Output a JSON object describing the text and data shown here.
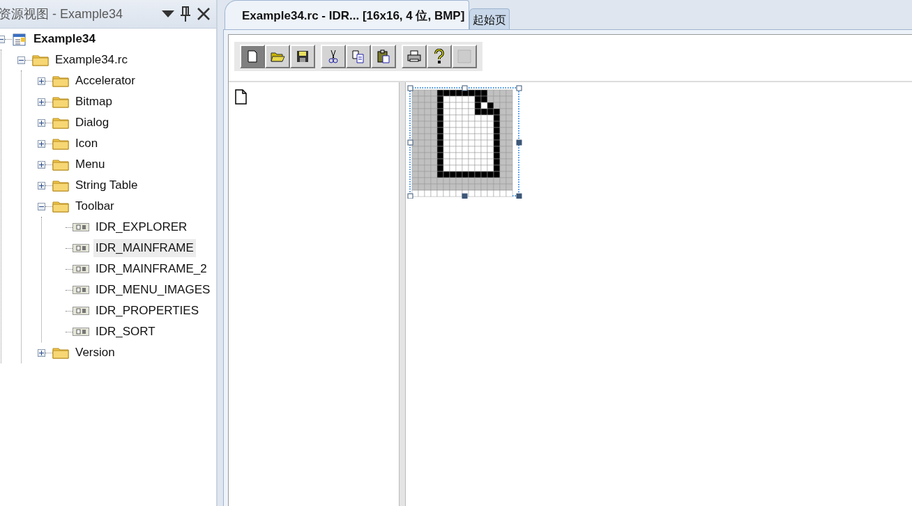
{
  "resource_view": {
    "title": "资源视图 - Example34",
    "tree": [
      {
        "label": "Example34",
        "kind": "project",
        "expanded": true,
        "selected": false,
        "children": [
          {
            "label": "Example34.rc",
            "kind": "folder",
            "expanded": true,
            "selected": false,
            "children": [
              {
                "label": "Accelerator",
                "kind": "folder",
                "expanded": false,
                "selected": false
              },
              {
                "label": "Bitmap",
                "kind": "folder",
                "expanded": false,
                "selected": false
              },
              {
                "label": "Dialog",
                "kind": "folder",
                "expanded": false,
                "selected": false
              },
              {
                "label": "Icon",
                "kind": "folder",
                "expanded": false,
                "selected": false
              },
              {
                "label": "Menu",
                "kind": "folder",
                "expanded": false,
                "selected": false
              },
              {
                "label": "String Table",
                "kind": "folder",
                "expanded": false,
                "selected": false
              },
              {
                "label": "Toolbar",
                "kind": "folder",
                "expanded": true,
                "selected": false,
                "children": [
                  {
                    "label": "IDR_EXPLORER",
                    "kind": "toolbar",
                    "selected": false
                  },
                  {
                    "label": "IDR_MAINFRAME",
                    "kind": "toolbar",
                    "selected": true
                  },
                  {
                    "label": "IDR_MAINFRAME_2",
                    "kind": "toolbar",
                    "selected": false
                  },
                  {
                    "label": "IDR_MENU_IMAGES",
                    "kind": "toolbar",
                    "selected": false
                  },
                  {
                    "label": "IDR_PROPERTIES",
                    "kind": "toolbar",
                    "selected": false
                  },
                  {
                    "label": "IDR_SORT",
                    "kind": "toolbar",
                    "selected": false
                  }
                ]
              },
              {
                "label": "Version",
                "kind": "folder",
                "expanded": false,
                "selected": false
              }
            ]
          }
        ]
      }
    ]
  },
  "tabs": [
    {
      "label": "Example34.rc - IDR... [16x16, 4 位, BMP]",
      "selected": true
    },
    {
      "label": "起始页",
      "selected": false
    }
  ],
  "toolbar_buttons": [
    [
      {
        "kind": "new",
        "selected": true
      },
      {
        "kind": "open",
        "selected": false
      },
      {
        "kind": "save",
        "selected": false
      }
    ],
    [
      {
        "kind": "cut",
        "selected": false
      },
      {
        "kind": "copy",
        "selected": false
      },
      {
        "kind": "paste",
        "selected": false
      }
    ],
    [
      {
        "kind": "print",
        "selected": false
      },
      {
        "kind": "help",
        "selected": false
      },
      {
        "kind": "blank",
        "selected": false
      }
    ]
  ]
}
